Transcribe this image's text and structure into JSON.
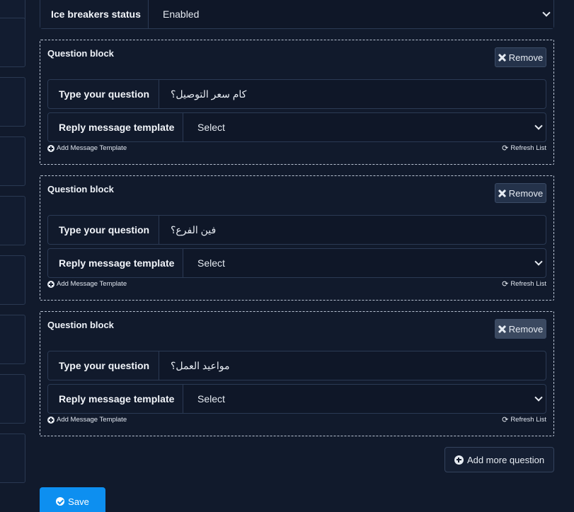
{
  "status": {
    "label": "Ice breakers status",
    "value": "Enabled"
  },
  "question_blocks": [
    {
      "title": "Question block",
      "remove_label": "Remove",
      "question_label": "Type your question",
      "question_value": "كام سعر التوصيل؟",
      "reply_label": "Reply message template",
      "reply_value": "Select",
      "add_template_label": "Add Message Template",
      "refresh_label": "Refresh List"
    },
    {
      "title": "Question block",
      "remove_label": "Remove",
      "question_label": "Type your question",
      "question_value": "فين الفرع؟",
      "reply_label": "Reply message template",
      "reply_value": "Select",
      "add_template_label": "Add Message Template",
      "refresh_label": "Refresh List"
    },
    {
      "title": "Question block",
      "remove_label": "Remove",
      "question_label": "Type your question",
      "question_value": "مواعيد العمل؟",
      "reply_label": "Reply message template",
      "reply_value": "Select",
      "add_template_label": "Add Message Template",
      "refresh_label": "Refresh List"
    }
  ],
  "actions": {
    "add_more_label": "Add more question",
    "save_label": "Save"
  },
  "icons": {
    "remove": "x-icon",
    "add_template": "plus-circle-icon",
    "refresh": "refresh-icon",
    "add_more": "plus-circle-icon",
    "save": "check-circle-icon"
  },
  "colors": {
    "background": "#111a2c",
    "save_button": "#0d8ff0",
    "remove_button": "#24324a"
  }
}
